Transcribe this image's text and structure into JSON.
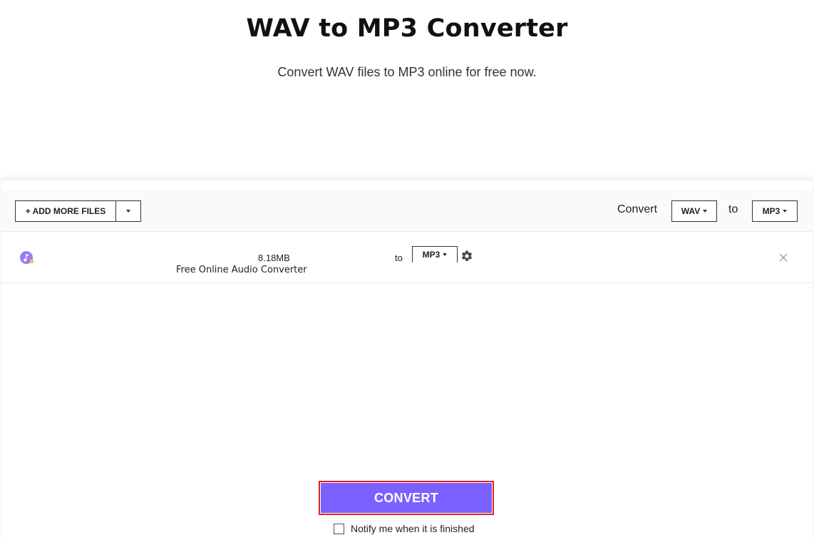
{
  "hero": {
    "title": "WAV to MP3 Converter",
    "subtitle": "Convert WAV files to MP3 online for free now."
  },
  "toolbar": {
    "add_files_label": "+ ADD MORE FILES",
    "add_files_dropdown_icon": "caret-down-icon",
    "convert_label": "Convert",
    "from_format": "WAV",
    "to_label": "to",
    "to_format": "MP3"
  },
  "file_row": {
    "icon": "audio-file-icon",
    "size": "8.18MB",
    "name": "Free Online Audio Converter",
    "to_label": "to",
    "format": "MP3",
    "settings_icon": "gear-icon",
    "remove_icon": "close-icon"
  },
  "actions": {
    "convert_button": "CONVERT",
    "notify_label": "Notify me when it is finished",
    "notify_checked": false
  },
  "colors": {
    "accent": "#7b61ff",
    "highlight_border": "#e0201c",
    "file_icon": "#9b7bf5",
    "file_icon_badge": "#f6c343"
  }
}
